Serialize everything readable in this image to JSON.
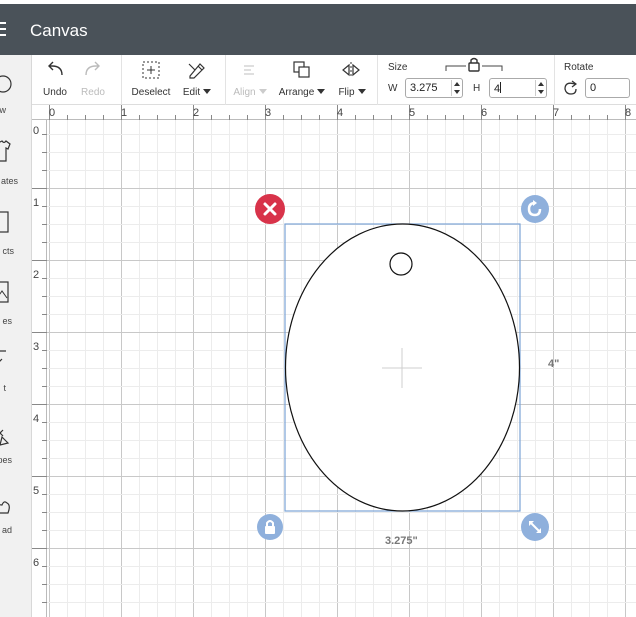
{
  "app": {
    "title": "Canvas"
  },
  "sidebar": {
    "items": [
      {
        "label": "w",
        "icon": "new-circle-icon"
      },
      {
        "label": "ates",
        "icon": "shirt-icon"
      },
      {
        "label": "cts",
        "icon": "projects-icon"
      },
      {
        "label": "es",
        "icon": "image-icon"
      },
      {
        "label": "t",
        "icon": "text-icon"
      },
      {
        "label": "pes",
        "icon": "shapes-icon"
      },
      {
        "label": "ad",
        "icon": "upload-icon"
      }
    ]
  },
  "toolbar": {
    "undo": "Undo",
    "redo": "Redo",
    "deselect": "Deselect",
    "edit": "Edit",
    "align": "Align",
    "arrange": "Arrange",
    "flip": "Flip",
    "size_label": "Size",
    "w_label": "W",
    "w_value": "3.275",
    "h_label": "H",
    "h_value": "4",
    "rotate_label": "Rotate",
    "rotate_value": "0"
  },
  "rulers": {
    "top": [
      "0",
      "1",
      "2",
      "3",
      "4",
      "5",
      "6",
      "7",
      "8"
    ],
    "left": [
      "0",
      "1",
      "2",
      "3",
      "4",
      "5",
      "6"
    ]
  },
  "selection": {
    "width_label": "3.275\"",
    "height_label": "4\""
  },
  "colors": {
    "topbar": "#4a5259",
    "delete_handle": "#d8334a",
    "handle_blue": "#8fb0dc",
    "selection_box": "#7ba3d6",
    "grid_major": "#c8c8c8",
    "grid_minor": "#ececec"
  }
}
